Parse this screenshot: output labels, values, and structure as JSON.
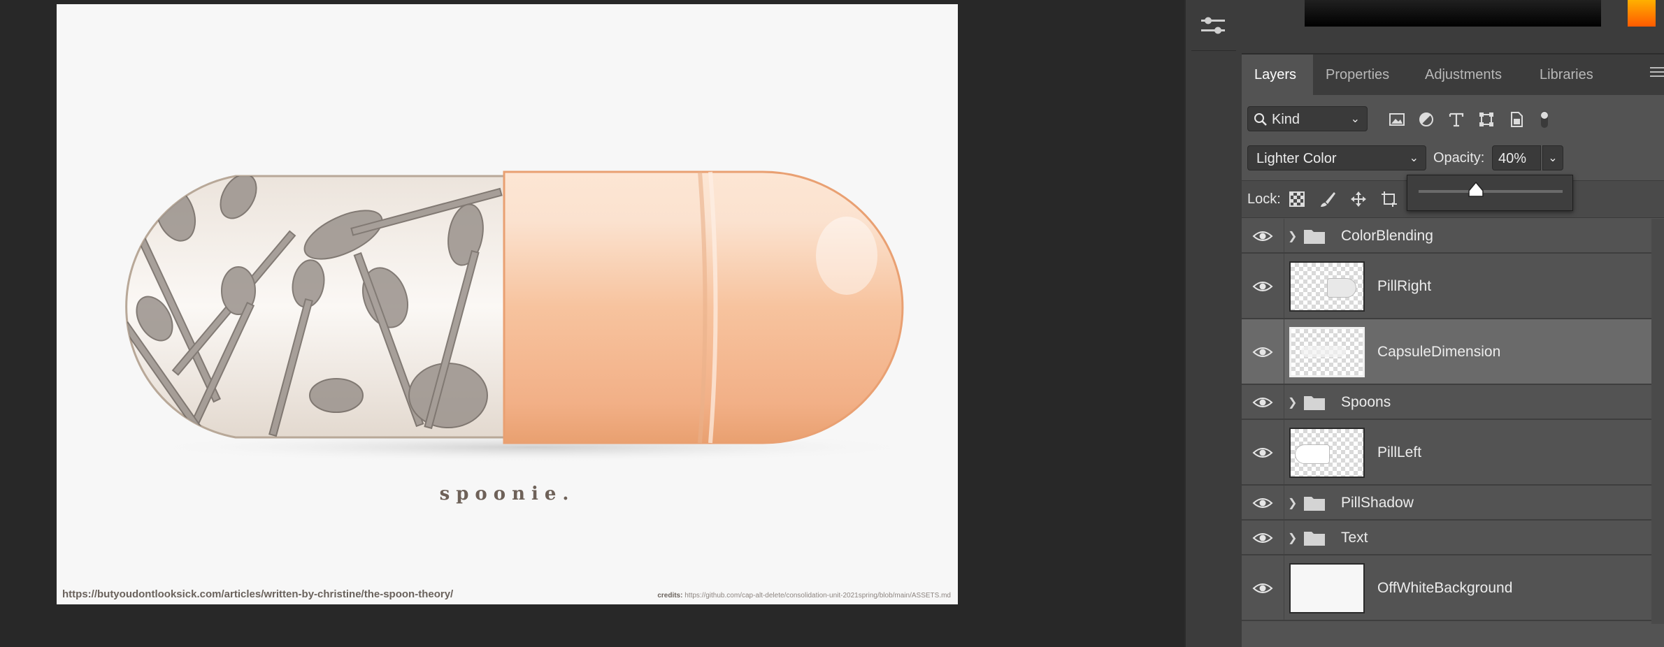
{
  "document": {
    "tagline": "spoonie.",
    "source_url": "https://butyoudontlooksick.com/articles/written-by-christine/the-spoon-theory/",
    "credits_label": "credits:",
    "credits_url": "https://github.com/cap-alt-delete/consolidation-unit-2021spring/blob/main/ASSETS.md"
  },
  "panel": {
    "tabs": [
      {
        "label": "Layers",
        "active": true
      },
      {
        "label": "Properties",
        "active": false
      },
      {
        "label": "Adjustments",
        "active": false
      },
      {
        "label": "Libraries",
        "active": false
      }
    ],
    "filter": {
      "kind_label": "Kind",
      "icons": [
        "image-filter-icon",
        "adjustment-filter-icon",
        "type-filter-icon",
        "shape-filter-icon",
        "smart-object-filter-icon",
        "filter-toggle-icon"
      ]
    },
    "blend_mode": "Lighter Color",
    "opacity_label": "Opacity:",
    "opacity_value": "40%",
    "opacity_slider_fraction": 0.4,
    "lock_label": "Lock:",
    "lock_icons": [
      "lock-transparent-pixels-icon",
      "lock-image-pixels-icon",
      "lock-position-icon",
      "lock-artboard-icon"
    ]
  },
  "layers": [
    {
      "name": "ColorBlending",
      "type": "group",
      "visible": true,
      "selected": false
    },
    {
      "name": "PillRight",
      "type": "layer",
      "visible": true,
      "selected": false
    },
    {
      "name": "CapsuleDimension",
      "type": "layer",
      "visible": true,
      "selected": true
    },
    {
      "name": "Spoons",
      "type": "group",
      "visible": true,
      "selected": false
    },
    {
      "name": "PillLeft",
      "type": "layer",
      "visible": true,
      "selected": false
    },
    {
      "name": "PillShadow",
      "type": "group",
      "visible": true,
      "selected": false
    },
    {
      "name": "Text",
      "type": "group",
      "visible": true,
      "selected": false
    },
    {
      "name": "OffWhiteBackground",
      "type": "layer",
      "visible": true,
      "selected": false
    }
  ],
  "colors": {
    "app_background": "#282828",
    "panel_background": "#535353",
    "selected_layer": "#6a6a6a",
    "capsule_peach": "#f6c29c",
    "document_background": "#f7f7f7"
  }
}
